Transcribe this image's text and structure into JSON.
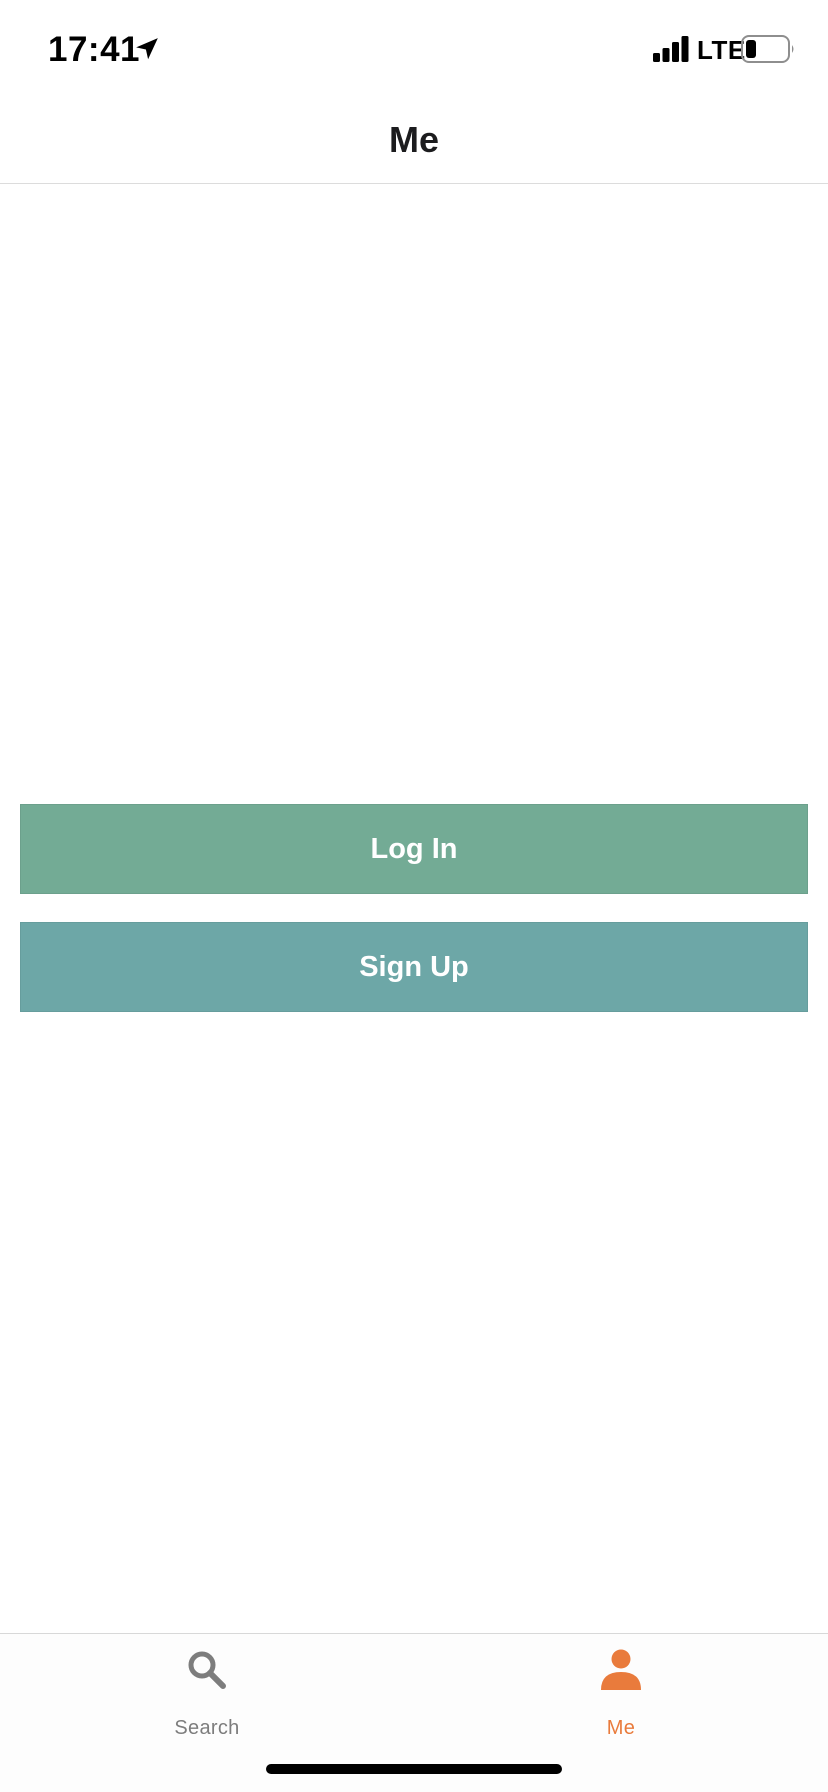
{
  "status_bar": {
    "time": "17:41",
    "network": "LTE",
    "icons": [
      "location-arrow-icon",
      "cellular-signal-icon",
      "battery-icon"
    ]
  },
  "nav": {
    "title": "Me"
  },
  "actions": {
    "login_label": "Log In",
    "signup_label": "Sign Up"
  },
  "tab_bar": {
    "tabs": [
      {
        "label": "Search",
        "icon": "search-icon",
        "selected": false
      },
      {
        "label": "Me",
        "icon": "person-icon",
        "selected": true
      }
    ]
  },
  "colors": {
    "login_button": "#73ab95",
    "signup_button": "#6da7a7",
    "tab_active": "#e97b3c",
    "tab_inactive": "#7d7d7d"
  }
}
